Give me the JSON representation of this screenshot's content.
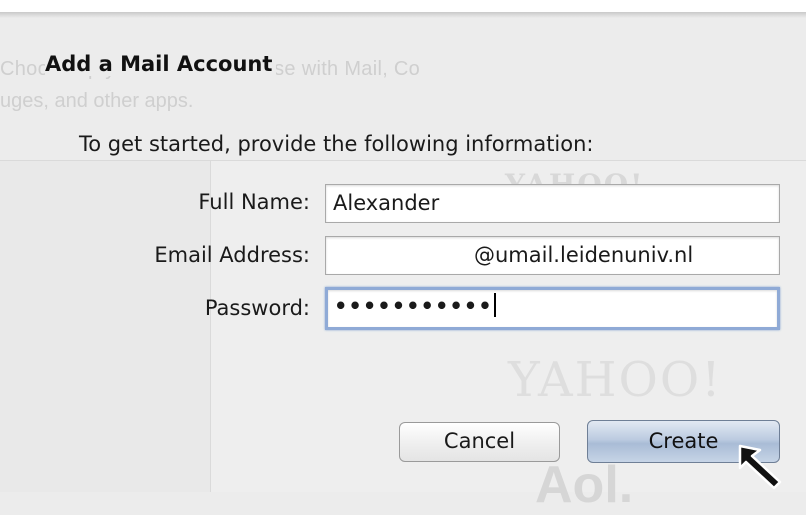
{
  "background": {
    "line1": "Choose up your accounts to use with Mail, Co",
    "line2": "uges, and other apps.",
    "logo_top": "YAHOO! ",
    "logo_mid": "YAHOO!",
    "logo_bottom": "Aol."
  },
  "sheet": {
    "title": "Add a Mail Account",
    "intro": "To get started, provide the following information:"
  },
  "form": {
    "full_name_label": "Full Name:",
    "full_name_value": "Alexander",
    "email_label": "Email Address:",
    "email_value": "@umail.leidenuniv.nl",
    "password_label": "Password:",
    "password_value": "•••••••••••"
  },
  "buttons": {
    "cancel": "Cancel",
    "create": "Create"
  },
  "colors": {
    "focus_ring": "#8faad6",
    "default_button": "#a9bcd6"
  }
}
